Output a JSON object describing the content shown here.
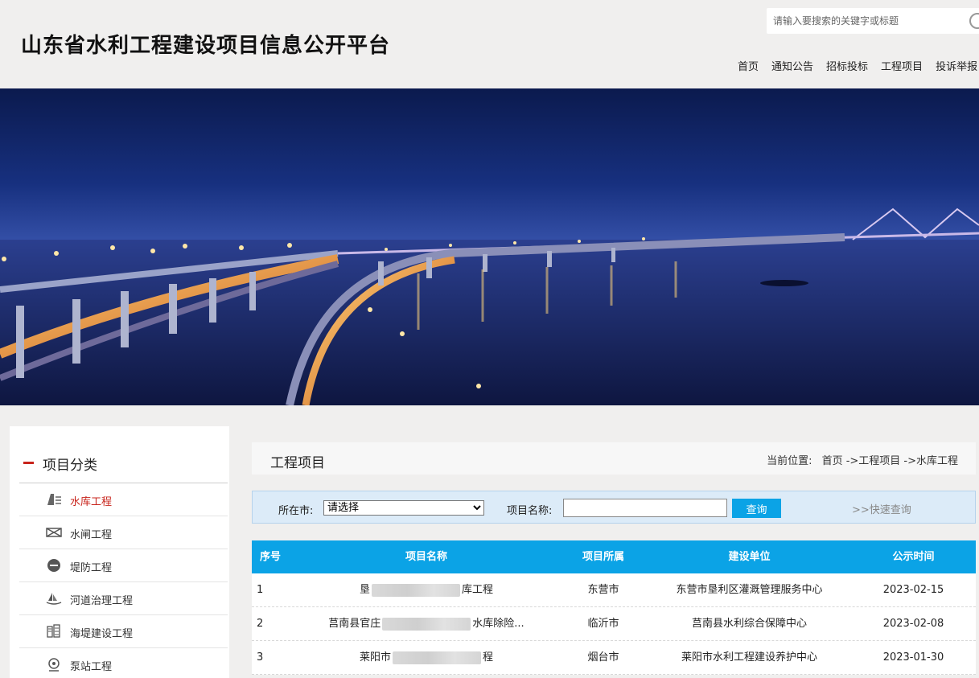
{
  "site": {
    "title": "山东省水利工程建设项目信息公开平台"
  },
  "search": {
    "placeholder": "请输入要搜索的关键字或标题"
  },
  "nav": [
    "首页",
    "通知公告",
    "招标投标",
    "工程项目",
    "投诉举报"
  ],
  "sidebar": {
    "title": "项目分类",
    "items": [
      {
        "label": "水库工程",
        "icon": "dam-icon",
        "active": true
      },
      {
        "label": "水闸工程",
        "icon": "sluice-icon"
      },
      {
        "label": "堤防工程",
        "icon": "no-entry-icon"
      },
      {
        "label": "河道治理工程",
        "icon": "boat-icon"
      },
      {
        "label": "海堤建设工程",
        "icon": "seawall-icon"
      },
      {
        "label": "泵站工程",
        "icon": "pump-icon"
      }
    ]
  },
  "main": {
    "title": "工程项目",
    "breadcrumb": {
      "prefix": "当前位置:",
      "path": "首页 ->工程项目 ->水库工程"
    }
  },
  "filter": {
    "city_label": "所在市:",
    "city_selected": "请选择",
    "name_label": "项目名称:",
    "name_value": "",
    "query_label": "查询",
    "quick_label": ">>快速查询"
  },
  "table": {
    "headers": [
      "序号",
      "项目名称",
      "项目所属",
      "建设单位",
      "公示时间"
    ],
    "rows": [
      {
        "no": "1",
        "name_a": "垦",
        "name_b": "库工程",
        "city": "东营市",
        "unit": "东营市垦利区灌溉管理服务中心",
        "date": "2023-02-15"
      },
      {
        "no": "2",
        "name_a": "莒南县官庄",
        "name_b": "水库除险...",
        "city": "临沂市",
        "unit": "莒南县水利综合保障中心",
        "date": "2023-02-08"
      },
      {
        "no": "3",
        "name_a": "莱阳市",
        "name_b": "程",
        "city": "烟台市",
        "unit": "莱阳市水利工程建设养护中心",
        "date": "2023-01-30"
      }
    ]
  },
  "colors": {
    "accent_blue": "#0ba3e6",
    "active_red": "#c8241c",
    "filter_bg": "#dcebf8"
  }
}
